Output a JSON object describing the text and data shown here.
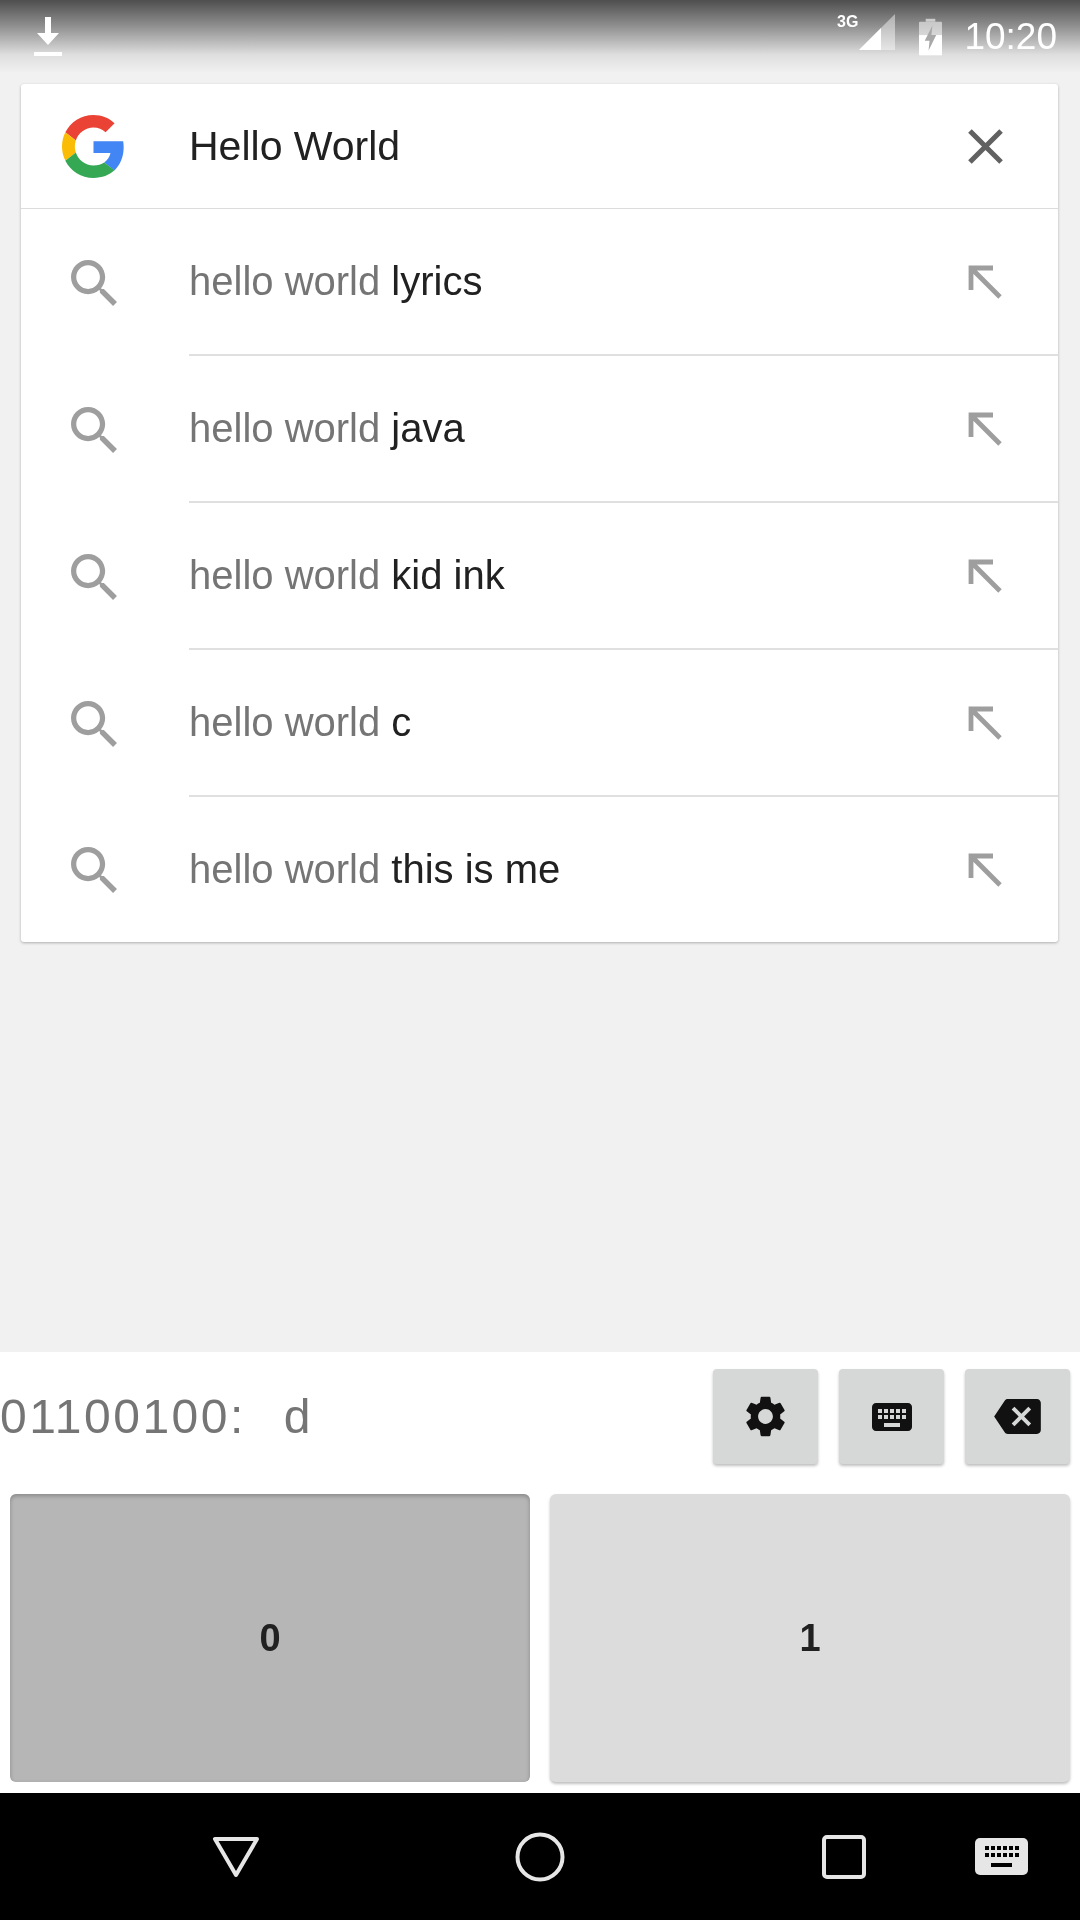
{
  "status_bar": {
    "network": "3G",
    "time": "10:20"
  },
  "search": {
    "value": "Hello World"
  },
  "suggestions": [
    {
      "query": "hello world",
      "completion": "lyrics"
    },
    {
      "query": "hello world",
      "completion": "java"
    },
    {
      "query": "hello world",
      "completion": "kid ink"
    },
    {
      "query": "hello world",
      "completion": "c"
    },
    {
      "query": "hello world",
      "completion": "this is me"
    }
  ],
  "keyboard": {
    "preview": "01100100: d",
    "keys": [
      {
        "label": "0",
        "pressed": true
      },
      {
        "label": "1",
        "pressed": false
      }
    ]
  }
}
